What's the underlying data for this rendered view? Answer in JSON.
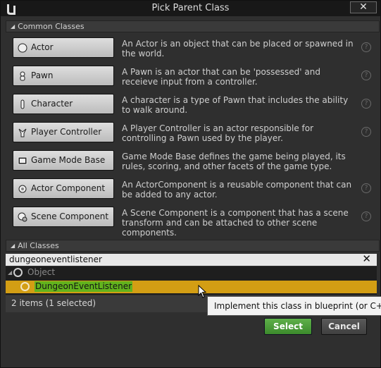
{
  "window": {
    "title": "Pick Parent Class",
    "close_symbol": "✕"
  },
  "common": {
    "header": "Common Classes",
    "items": [
      {
        "label": "Actor",
        "icon": "actor-icon",
        "description": "An Actor is an object that can be placed or spawned in the world."
      },
      {
        "label": "Pawn",
        "icon": "pawn-icon",
        "description": "A Pawn is an actor that can be 'possessed' and receieve input from a controller."
      },
      {
        "label": "Character",
        "icon": "character-icon",
        "description": "A character is a type of Pawn that includes the ability to walk around."
      },
      {
        "label": "Player Controller",
        "icon": "player-controller-icon",
        "description": "A Player Controller is an actor responsible for controlling a Pawn used by the player."
      },
      {
        "label": "Game Mode Base",
        "icon": "game-mode-icon",
        "description": "Game Mode Base defines the game being played, its rules, scoring, and other facets of the game type."
      },
      {
        "label": "Actor Component",
        "icon": "actor-component-icon",
        "description": "An ActorComponent is a reusable component that can be added to any actor."
      },
      {
        "label": "Scene Component",
        "icon": "scene-component-icon",
        "description": "A Scene Component is a component that has a scene transform and can be attached to other scene components."
      }
    ],
    "help_symbol": "?"
  },
  "all": {
    "header": "All Classes",
    "search_value": "dungeoneventlistener",
    "clear_symbol": "✕",
    "tree": {
      "root_label": "Object",
      "selected_label": "DungeonEventListener"
    },
    "status": "2 items (1 selected)"
  },
  "tooltip": "Implement this class in blueprint (or C++) to",
  "buttons": {
    "select": "Select",
    "cancel": "Cancel"
  },
  "colors": {
    "selected_row": "#d39e14",
    "highlight": "#62b31d",
    "select_button": "#4c9d3a"
  }
}
